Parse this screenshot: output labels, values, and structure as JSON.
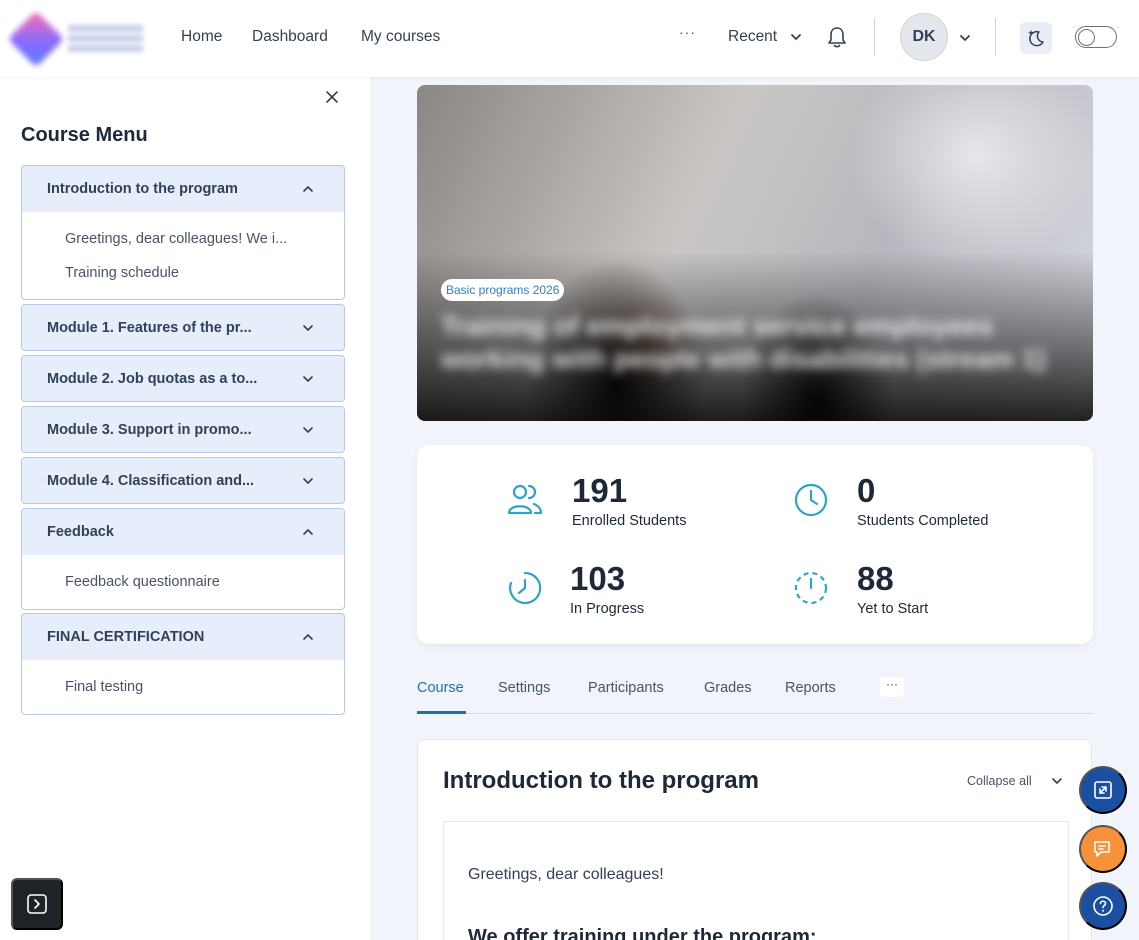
{
  "nav": {
    "links": [
      "Home",
      "Dashboard",
      "My courses"
    ],
    "more": "···",
    "recent": "Recent",
    "avatar_initials": "DK"
  },
  "sidebar": {
    "title": "Course Menu",
    "sections": [
      {
        "title": "Introduction to the program",
        "expanded": true,
        "items": [
          "Greetings, dear colleagues! We i...",
          "Training schedule"
        ]
      },
      {
        "title": "Module 1. Features of the pr...",
        "expanded": false,
        "items": []
      },
      {
        "title": "Module 2. Job quotas as a to...",
        "expanded": false,
        "items": []
      },
      {
        "title": "Module 3. Support in promo...",
        "expanded": false,
        "items": []
      },
      {
        "title": "Module 4. Classification and...",
        "expanded": false,
        "items": []
      },
      {
        "title": "Feedback",
        "expanded": true,
        "items": [
          "Feedback questionnaire"
        ]
      },
      {
        "title": "FINAL CERTIFICATION",
        "expanded": true,
        "items": [
          "Final testing"
        ]
      }
    ]
  },
  "hero": {
    "badge": "Basic programs 2026",
    "title": "Training of employment service employees working with people with disabilities (stream 1)"
  },
  "stats": {
    "enrolled": {
      "value": "191",
      "label": "Enrolled Students"
    },
    "completed": {
      "value": "0",
      "label": "Students Completed"
    },
    "in_progress": {
      "value": "103",
      "label": "In Progress"
    },
    "yet_to_start": {
      "value": "88",
      "label": "Yet to Start"
    }
  },
  "tabs": {
    "items": [
      "Course",
      "Settings",
      "Participants",
      "Grades",
      "Reports"
    ],
    "active": "Course",
    "more": "···"
  },
  "content": {
    "title": "Introduction to the program",
    "collapse_all": "Collapse all",
    "greeting": "Greetings, dear colleagues!",
    "offer": "We offer training under the program:"
  },
  "colors": {
    "accent": "#1f6fb5",
    "icon_teal": "#2ea3c9",
    "fab_blue": "#1b4fa2",
    "fab_orange": "#f7923a",
    "section_head": "#e6edfb"
  }
}
